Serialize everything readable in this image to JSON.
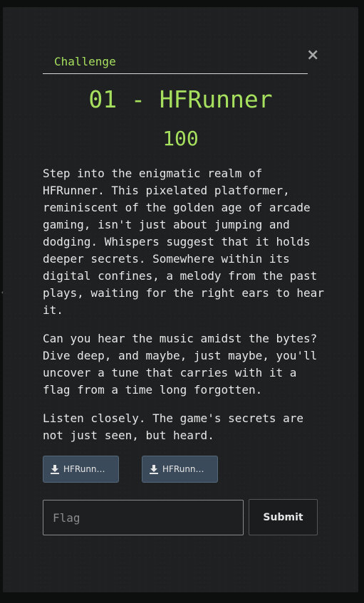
{
  "modal": {
    "tab_label": "Challenge",
    "close_glyph": "×",
    "title": "01 - HFRunner",
    "points": "100",
    "description": [
      "Step into the enigmatic realm of HFRunner. This pixelated platformer, reminiscent of the golden age of arcade gaming, isn't just about jumping and dodging. Whispers suggest that it holds deeper secrets. Somewhere within its digital confines, a melody from the past plays, waiting for the right ears to hear it.",
      "Can you hear the music amidst the bytes? Dive deep, and maybe, just maybe, you'll uncover a tune that carries with it a flag from a time long forgotten.",
      "Listen closely. The game's secrets are not just seen, but heard."
    ],
    "files": [
      {
        "label": "HFRunner...",
        "icon": "download-icon"
      },
      {
        "label": "HFRunner...",
        "icon": "download-icon"
      }
    ],
    "flag_input": {
      "value": "",
      "placeholder": "Flag"
    },
    "submit_label": "Submit"
  },
  "colors": {
    "accent": "#a6e05e",
    "modal_bg": "#1f2021",
    "file_button_bg": "#3a4a5a"
  }
}
